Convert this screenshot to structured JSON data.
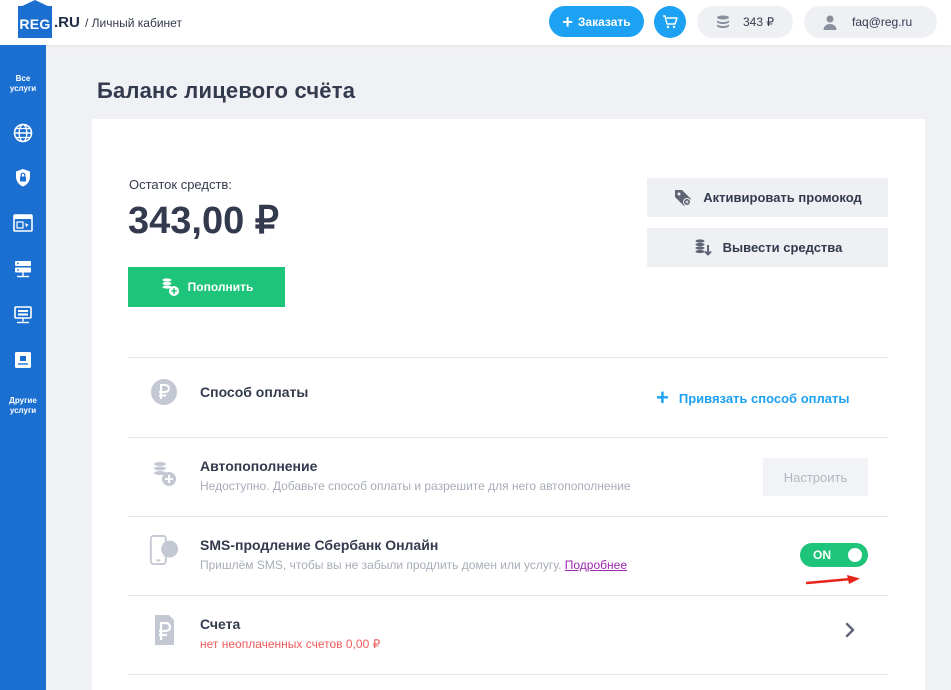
{
  "header": {
    "logo_main": "REG",
    "logo_suffix": ".RU",
    "breadcrumb": "/ Личный кабинет",
    "order_label": "Заказать",
    "balance": "343 ₽",
    "user": "faq@reg.ru",
    "accent": "#1da1f2"
  },
  "sidebar": {
    "all_services": [
      "Все",
      "услуги"
    ],
    "other_services": [
      "Другие",
      "услуги"
    ],
    "icons": [
      "globe-icon",
      "shield-lock-icon",
      "browser-window-icon",
      "server-icon",
      "monitor-network-icon",
      "vps-icon"
    ],
    "color": "#1b6fd1"
  },
  "page": {
    "title": "Баланс лицевого счёта"
  },
  "balance": {
    "label": "Остаток средств:",
    "amount": "343,00 ₽",
    "topup_label": "Пополнить",
    "promo_label": "Активировать промокод",
    "withdraw_label": "Вывести средства"
  },
  "rows": {
    "payment": {
      "title": "Способ оплаты",
      "action": "Привязать способ оплаты"
    },
    "autopay": {
      "title": "Автопополнение",
      "subtitle": "Недоступно. Добавьте способ оплаты и разрешите для него автопополнение",
      "action": "Настроить"
    },
    "sms": {
      "title": "SMS-продление Сбербанк Онлайн",
      "subtitle": "Пришлём SMS, чтобы вы не забыли продлить домен или услугу.",
      "link": "Подробнее",
      "toggle": "ON"
    },
    "invoices": {
      "title": "Счета",
      "subtitle": "нет неоплаченных счетов 0,00 ₽"
    }
  },
  "colors": {
    "green": "#1dc479",
    "red": "#f05a5a",
    "text": "#333a4d",
    "muted": "#a7acb8"
  }
}
